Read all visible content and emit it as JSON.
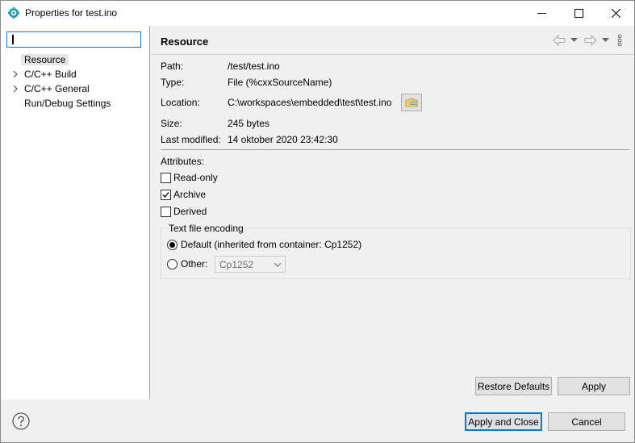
{
  "window": {
    "title": "Properties for test.ino"
  },
  "filter": {
    "value": "",
    "placeholder": ""
  },
  "tree": {
    "items": [
      {
        "label": "Resource",
        "expandable": false,
        "selected": true
      },
      {
        "label": "C/C++ Build",
        "expandable": true,
        "selected": false
      },
      {
        "label": "C/C++ General",
        "expandable": true,
        "selected": false
      },
      {
        "label": "Run/Debug Settings",
        "expandable": false,
        "selected": false
      }
    ]
  },
  "page": {
    "title": "Resource",
    "properties": {
      "path_label": "Path:",
      "path_value": "/test/test.ino",
      "type_label": "Type:",
      "type_value": "File  (%cxxSourceName)",
      "location_label": "Location:",
      "location_value": "C:\\workspaces\\embedded\\test\\test.ino",
      "size_label": "Size:",
      "size_value": "245  bytes",
      "modified_label": "Last modified:",
      "modified_value": "14 oktober 2020 23:42:30"
    },
    "attributes": {
      "heading": "Attributes:",
      "read_only": {
        "label": "Read-only",
        "checked": false
      },
      "archive": {
        "label": "Archive",
        "checked": true
      },
      "derived": {
        "label": "Derived",
        "checked": false
      }
    },
    "encoding": {
      "legend": "Text file encoding",
      "default_label": "Default (inherited from container: Cp1252)",
      "other_label": "Other:",
      "other_value": "Cp1252",
      "selected": "default"
    },
    "buttons": {
      "restore_defaults": "Restore Defaults",
      "apply": "Apply"
    }
  },
  "footer": {
    "apply_and_close": "Apply and Close",
    "cancel": "Cancel"
  },
  "colors": {
    "accent": "#0078d7",
    "icon_teal": "#1e9bb5"
  }
}
